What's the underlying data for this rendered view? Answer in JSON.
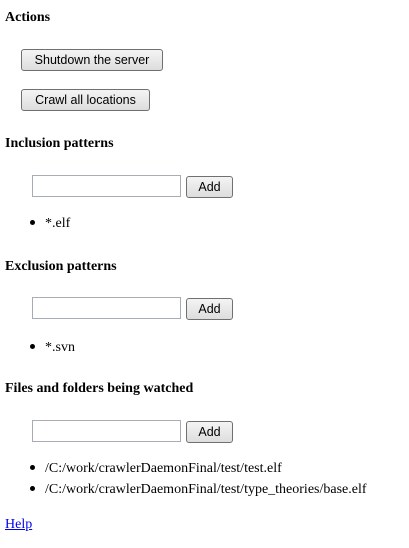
{
  "actions": {
    "heading": "Actions",
    "shutdown_label": "Shutdown the server",
    "crawl_label": "Crawl all locations"
  },
  "inclusion": {
    "heading": "Inclusion patterns",
    "input_value": "",
    "add_label": "Add",
    "items": [
      "*.elf"
    ]
  },
  "exclusion": {
    "heading": "Exclusion patterns",
    "input_value": "",
    "add_label": "Add",
    "items": [
      "*.svn"
    ]
  },
  "watched": {
    "heading": "Files and folders being watched",
    "input_value": "",
    "add_label": "Add",
    "items": [
      "/C:/work/crawlerDaemonFinal/test/test.elf",
      "/C:/work/crawlerDaemonFinal/test/type_theories/base.elf"
    ]
  },
  "footer": {
    "help_label": "Help"
  }
}
